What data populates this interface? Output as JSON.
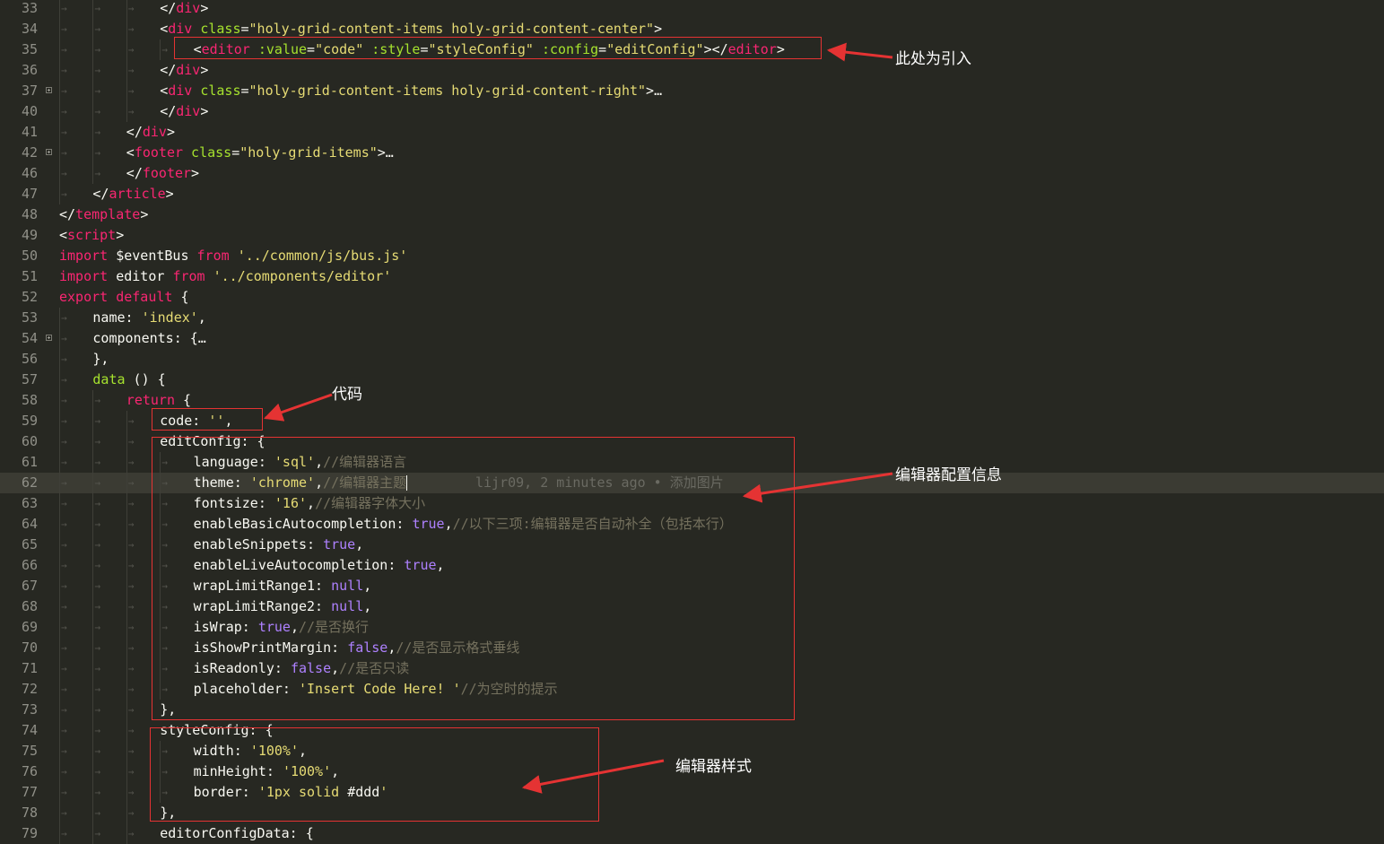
{
  "code_lines": [
    {
      "n": "33",
      "indent": 3,
      "tokens": [
        [
          "p",
          "</"
        ],
        [
          "t",
          "div"
        ],
        [
          "p",
          ">"
        ]
      ]
    },
    {
      "n": "34",
      "indent": 3,
      "tokens": [
        [
          "p",
          "<"
        ],
        [
          "t",
          "div"
        ],
        [
          "p",
          " "
        ],
        [
          "a",
          "class"
        ],
        [
          "p",
          "="
        ],
        [
          "s",
          "\"holy-grid-content-items holy-grid-content-center\""
        ],
        [
          "p",
          ">"
        ]
      ]
    },
    {
      "n": "35",
      "indent": 4,
      "tokens": [
        [
          "p",
          "<"
        ],
        [
          "t",
          "editor"
        ],
        [
          "p",
          " "
        ],
        [
          "a",
          ":value"
        ],
        [
          "p",
          "="
        ],
        [
          "s",
          "\"code\""
        ],
        [
          "p",
          " "
        ],
        [
          "a",
          ":style"
        ],
        [
          "p",
          "="
        ],
        [
          "s",
          "\"styleConfig\""
        ],
        [
          "p",
          " "
        ],
        [
          "a",
          ":config"
        ],
        [
          "p",
          "="
        ],
        [
          "s",
          "\"editConfig\""
        ],
        [
          "p",
          "></"
        ],
        [
          "t",
          "editor"
        ],
        [
          "p",
          ">"
        ]
      ]
    },
    {
      "n": "36",
      "indent": 3,
      "tokens": [
        [
          "p",
          "</"
        ],
        [
          "t",
          "div"
        ],
        [
          "p",
          ">"
        ]
      ]
    },
    {
      "n": "37",
      "indent": 3,
      "fold": true,
      "tokens": [
        [
          "p",
          "<"
        ],
        [
          "t",
          "div"
        ],
        [
          "p",
          " "
        ],
        [
          "a",
          "class"
        ],
        [
          "p",
          "="
        ],
        [
          "s",
          "\"holy-grid-content-items holy-grid-content-right\""
        ],
        [
          "p",
          ">…"
        ]
      ]
    },
    {
      "n": "40",
      "indent": 3,
      "tokens": [
        [
          "p",
          "</"
        ],
        [
          "t",
          "div"
        ],
        [
          "p",
          ">"
        ]
      ]
    },
    {
      "n": "41",
      "indent": 2,
      "tokens": [
        [
          "p",
          "</"
        ],
        [
          "t",
          "div"
        ],
        [
          "p",
          ">"
        ]
      ]
    },
    {
      "n": "42",
      "indent": 2,
      "fold": true,
      "tokens": [
        [
          "p",
          "<"
        ],
        [
          "t",
          "footer"
        ],
        [
          "p",
          " "
        ],
        [
          "a",
          "class"
        ],
        [
          "p",
          "="
        ],
        [
          "s",
          "\"holy-grid-items\""
        ],
        [
          "p",
          ">…"
        ]
      ]
    },
    {
      "n": "46",
      "indent": 2,
      "tokens": [
        [
          "p",
          "</"
        ],
        [
          "t",
          "footer"
        ],
        [
          "p",
          ">"
        ]
      ]
    },
    {
      "n": "47",
      "indent": 1,
      "tokens": [
        [
          "p",
          "</"
        ],
        [
          "t",
          "article"
        ],
        [
          "p",
          ">"
        ]
      ]
    },
    {
      "n": "48",
      "indent": 0,
      "tokens": [
        [
          "p",
          "</"
        ],
        [
          "t",
          "template"
        ],
        [
          "p",
          ">"
        ]
      ]
    },
    {
      "n": "49",
      "indent": 0,
      "tokens": [
        [
          "p",
          "<"
        ],
        [
          "t",
          "script"
        ],
        [
          "p",
          ">"
        ]
      ]
    },
    {
      "n": "50",
      "indent": 0,
      "tokens": [
        [
          "k",
          "import"
        ],
        [
          "p",
          " $eventBus "
        ],
        [
          "k",
          "from"
        ],
        [
          "p",
          " "
        ],
        [
          "s",
          "'../common/js/bus.js'"
        ]
      ]
    },
    {
      "n": "51",
      "indent": 0,
      "tokens": [
        [
          "k",
          "import"
        ],
        [
          "p",
          " editor "
        ],
        [
          "k",
          "from"
        ],
        [
          "p",
          " "
        ],
        [
          "s",
          "'../components/editor'"
        ]
      ]
    },
    {
      "n": "52",
      "indent": 0,
      "tokens": [
        [
          "k",
          "export"
        ],
        [
          "p",
          " "
        ],
        [
          "k",
          "default"
        ],
        [
          "p",
          " {"
        ]
      ]
    },
    {
      "n": "53",
      "indent": 1,
      "tokens": [
        [
          "p",
          "name: "
        ],
        [
          "s",
          "'index'"
        ],
        [
          "p",
          ","
        ]
      ]
    },
    {
      "n": "54",
      "indent": 1,
      "fold": true,
      "tokens": [
        [
          "p",
          "components: {…"
        ]
      ]
    },
    {
      "n": "56",
      "indent": 1,
      "tokens": [
        [
          "p",
          "},"
        ]
      ]
    },
    {
      "n": "57",
      "indent": 1,
      "tokens": [
        [
          "f",
          "data"
        ],
        [
          "p",
          " () {"
        ]
      ]
    },
    {
      "n": "58",
      "indent": 2,
      "tokens": [
        [
          "k",
          "return"
        ],
        [
          "p",
          " {"
        ]
      ]
    },
    {
      "n": "59",
      "indent": 3,
      "tokens": [
        [
          "p",
          "code: "
        ],
        [
          "s",
          "''"
        ],
        [
          "p",
          ","
        ]
      ]
    },
    {
      "n": "60",
      "indent": 3,
      "tokens": [
        [
          "p",
          "editConfig: {"
        ]
      ]
    },
    {
      "n": "61",
      "indent": 4,
      "tokens": [
        [
          "p",
          "language: "
        ],
        [
          "s",
          "'sql'"
        ],
        [
          "p",
          ","
        ],
        [
          "c",
          "//编辑器语言"
        ]
      ]
    },
    {
      "n": "62",
      "indent": 4,
      "current": true,
      "caret": true,
      "blame": "lijr09, 2 minutes ago • 添加图片",
      "tokens": [
        [
          "p",
          "theme: "
        ],
        [
          "s",
          "'chrome'"
        ],
        [
          "p",
          ","
        ],
        [
          "c",
          "//编辑器主题"
        ]
      ]
    },
    {
      "n": "63",
      "indent": 4,
      "tokens": [
        [
          "p",
          "fontsize: "
        ],
        [
          "s",
          "'16'"
        ],
        [
          "p",
          ","
        ],
        [
          "c",
          "//编辑器字体大小"
        ]
      ]
    },
    {
      "n": "64",
      "indent": 4,
      "tokens": [
        [
          "p",
          "enableBasicAutocompletion: "
        ],
        [
          "n",
          "true"
        ],
        [
          "p",
          ","
        ],
        [
          "c",
          "//以下三项:编辑器是否自动补全（包括本行）"
        ]
      ]
    },
    {
      "n": "65",
      "indent": 4,
      "tokens": [
        [
          "p",
          "enableSnippets: "
        ],
        [
          "n",
          "true"
        ],
        [
          "p",
          ","
        ]
      ]
    },
    {
      "n": "66",
      "indent": 4,
      "tokens": [
        [
          "p",
          "enableLiveAutocompletion: "
        ],
        [
          "n",
          "true"
        ],
        [
          "p",
          ","
        ]
      ]
    },
    {
      "n": "67",
      "indent": 4,
      "tokens": [
        [
          "p",
          "wrapLimitRange1: "
        ],
        [
          "n",
          "null"
        ],
        [
          "p",
          ","
        ]
      ]
    },
    {
      "n": "68",
      "indent": 4,
      "tokens": [
        [
          "p",
          "wrapLimitRange2: "
        ],
        [
          "n",
          "null"
        ],
        [
          "p",
          ","
        ]
      ]
    },
    {
      "n": "69",
      "indent": 4,
      "tokens": [
        [
          "p",
          "isWrap: "
        ],
        [
          "n",
          "true"
        ],
        [
          "p",
          ","
        ],
        [
          "c",
          "//是否换行"
        ]
      ]
    },
    {
      "n": "70",
      "indent": 4,
      "tokens": [
        [
          "p",
          "isShowPrintMargin: "
        ],
        [
          "n",
          "false"
        ],
        [
          "p",
          ","
        ],
        [
          "c",
          "//是否显示格式垂线"
        ]
      ]
    },
    {
      "n": "71",
      "indent": 4,
      "tokens": [
        [
          "p",
          "isReadonly: "
        ],
        [
          "n",
          "false"
        ],
        [
          "p",
          ","
        ],
        [
          "c",
          "//是否只读"
        ]
      ]
    },
    {
      "n": "72",
      "indent": 4,
      "tokens": [
        [
          "p",
          "placeholder: "
        ],
        [
          "s",
          "'Insert Code Here! '"
        ],
        [
          "c",
          "//为空时的提示"
        ]
      ]
    },
    {
      "n": "73",
      "indent": 3,
      "tokens": [
        [
          "p",
          "},"
        ]
      ]
    },
    {
      "n": "74",
      "indent": 3,
      "tokens": [
        [
          "p",
          "styleConfig: {"
        ]
      ]
    },
    {
      "n": "75",
      "indent": 4,
      "tokens": [
        [
          "p",
          "width: "
        ],
        [
          "s",
          "'100%'"
        ],
        [
          "p",
          ","
        ]
      ]
    },
    {
      "n": "76",
      "indent": 4,
      "tokens": [
        [
          "p",
          "minHeight: "
        ],
        [
          "s",
          "'100%'"
        ],
        [
          "p",
          ","
        ]
      ]
    },
    {
      "n": "77",
      "indent": 4,
      "tokens": [
        [
          "p",
          "border: "
        ],
        [
          "s",
          "'1px solid "
        ],
        [
          "h",
          "#ddd"
        ],
        [
          "s",
          "'"
        ]
      ]
    },
    {
      "n": "78",
      "indent": 3,
      "tokens": [
        [
          "p",
          "},"
        ]
      ]
    },
    {
      "n": "79",
      "indent": 3,
      "tokens": [
        [
          "p",
          "editorConfigData: {"
        ]
      ]
    }
  ],
  "annotations": {
    "intro": "此处为引入",
    "code": "代码",
    "config_info": "编辑器配置信息",
    "style": "编辑器样式"
  },
  "colors": {
    "background": "#272822",
    "annotation_red": "#e53333",
    "tag": "#f92672",
    "attribute": "#a6e22e",
    "string": "#e6db74",
    "constant": "#ae81ff",
    "comment": "#75715e"
  }
}
